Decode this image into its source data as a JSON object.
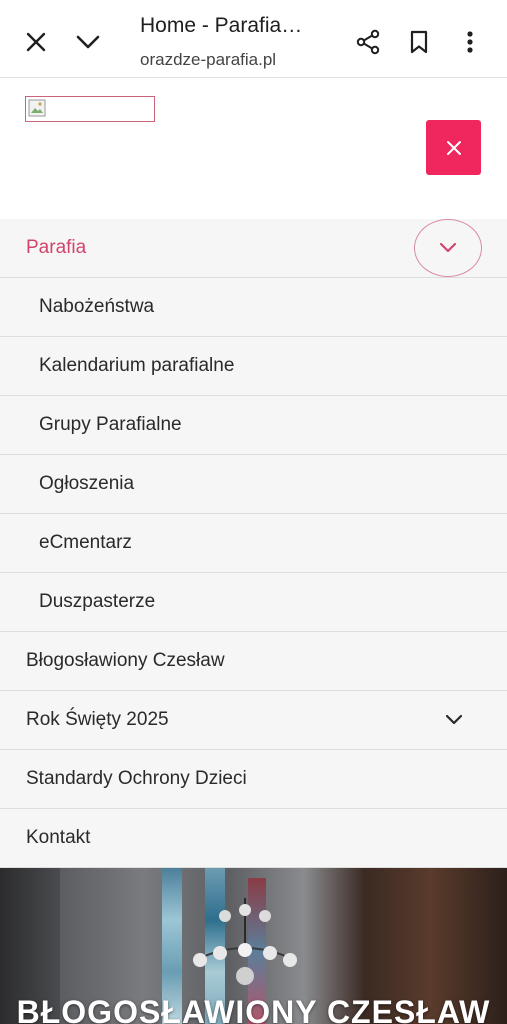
{
  "browser": {
    "title": "Home - Parafia…",
    "url": "orazdze-parafia.pl",
    "icons": [
      "close-icon",
      "chevron-down-icon",
      "share-icon",
      "bookmark-icon",
      "more-vert-icon"
    ]
  },
  "site": {
    "logo_alt": "",
    "accent_color": "#f0275f"
  },
  "menu": {
    "items": [
      {
        "label": "Parafia",
        "active": true,
        "has_toggle": true
      },
      {
        "label": "Nabożeństwa"
      },
      {
        "label": "Kalendarium parafialne"
      },
      {
        "label": "Grupy Parafialne"
      },
      {
        "label": "Ogłoszenia"
      },
      {
        "label": "eCmentarz"
      },
      {
        "label": "Duszpasterze"
      },
      {
        "label": "Błogosławiony Czesław"
      },
      {
        "label": "Rok Święty 2025",
        "has_toggle": true
      },
      {
        "label": "Standardy Ochrony Dzieci"
      },
      {
        "label": "Kontakt"
      }
    ]
  },
  "hero": {
    "title": "BŁOGOSŁAWIONY CZESŁAW"
  }
}
